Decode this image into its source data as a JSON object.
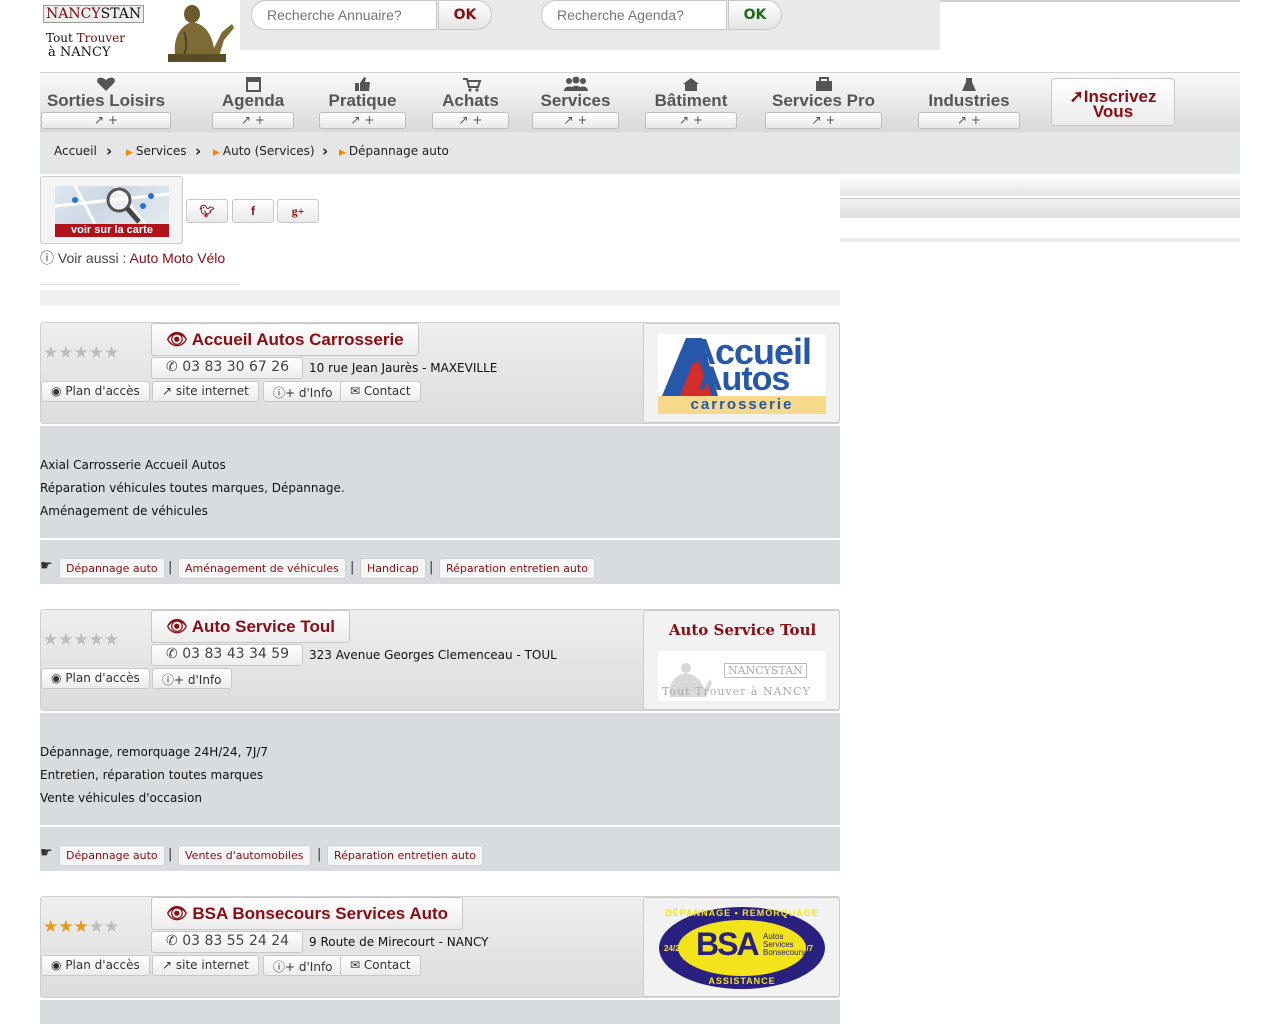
{
  "logo": {
    "brand_part1": "NANCY",
    "brand_part2": "STAN",
    "line2_a": "Tout ",
    "line2_b": "Trouver",
    "line3": "à NANCY"
  },
  "search": {
    "annuaire_placeholder": "Recherche Annuaire?",
    "agenda_placeholder": "Recherche Agenda?",
    "ok_label": "OK",
    "ok_color_1": "#8b0c12",
    "ok_color_2": "#1a6b1a"
  },
  "nav": {
    "items": [
      {
        "label": "Sorties Loisirs",
        "icon": "heart-icon",
        "plus": "↗ +"
      },
      {
        "label": "Agenda",
        "icon": "calendar-icon",
        "plus": "↗ +"
      },
      {
        "label": "Pratique",
        "icon": "thumbs-up-icon",
        "plus": "↗ +"
      },
      {
        "label": "Achats",
        "icon": "cart-icon",
        "plus": "↗ +"
      },
      {
        "label": "Services",
        "icon": "users-icon",
        "plus": "↗ +"
      },
      {
        "label": "Bâtiment",
        "icon": "home-icon",
        "plus": "↗ +"
      },
      {
        "label": "Services Pro",
        "icon": "briefcase-icon",
        "plus": "↗ +"
      },
      {
        "label": "Industries",
        "icon": "flask-icon",
        "plus": "↗ +"
      }
    ],
    "signup_line1": "Inscrivez",
    "signup_line2": "Vous"
  },
  "breadcrumb": [
    "Accueil",
    "Services",
    "Auto (Services)",
    "Dépannage auto"
  ],
  "map": {
    "label": "voir sur la carte"
  },
  "social": [
    "twitter-icon",
    "facebook-icon",
    "google-plus-icon"
  ],
  "see_also": {
    "prefix": "Voir aussi : ",
    "link": "Auto Moto Vélo"
  },
  "listings": [
    {
      "title": "Accueil Autos Carrosserie",
      "rating": 0,
      "phone": "03 83 30 67 26",
      "address": "10 rue Jean Jaurès - MAXEVILLE",
      "buttons": [
        "Plan d'accès",
        "site internet",
        "+ d'Info",
        "Contact"
      ],
      "logo_text": [
        "Accueil",
        "Autos",
        "carrosserie"
      ],
      "description": [
        "Axial Carrosserie Accueil Autos",
        "Réparation véhicules toutes marques, Dépannage.",
        "Aménagement de véhicules"
      ],
      "tags": [
        "Dépannage auto",
        "Aménagement de véhicules",
        "Handicap",
        "Réparation entretien auto"
      ]
    },
    {
      "title": "Auto Service Toul",
      "rating": 0,
      "phone": "03 83 43 34 59",
      "address": "323 Avenue Georges Clemenceau - TOUL",
      "buttons": [
        "Plan d'accès",
        "+ d'Info"
      ],
      "logo_text": [
        "Auto Service Toul",
        "NANCYSTAN",
        "Tout Trouver à NANCY"
      ],
      "description": [
        "Dépannage, remorquage 24H/24, 7J/7",
        "Entretien, réparation toutes marques",
        "Vente véhicules d'occasion"
      ],
      "tags": [
        "Dépannage auto",
        "Ventes d'automobiles",
        "Réparation entretien auto"
      ]
    },
    {
      "title": "BSA Bonsecours Services Auto",
      "rating": 3,
      "phone": "03 83 55 24 24",
      "address": "9 Route de Mirecourt - NANCY",
      "buttons": [
        "Plan d'accès",
        "site internet",
        "+ d'Info",
        "Contact"
      ],
      "logo_text": [
        "DÉPANNAGE • REMORQUAGE",
        "BSA",
        "Autos",
        "Services",
        "Bonsecours",
        "24/24",
        "7/7",
        "ASSISTANCE"
      ]
    }
  ]
}
